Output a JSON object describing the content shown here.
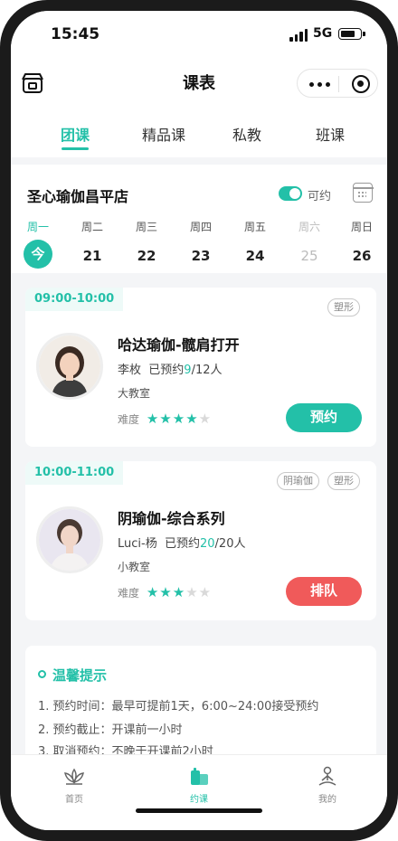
{
  "status": {
    "time": "15:45",
    "network": "5G"
  },
  "nav": {
    "title": "课表"
  },
  "tabs": [
    {
      "label": "团课",
      "active": true
    },
    {
      "label": "精品课",
      "active": false
    },
    {
      "label": "私教",
      "active": false
    },
    {
      "label": "班课",
      "active": false
    }
  ],
  "studio": {
    "name": "圣心瑜伽昌平店",
    "toggle_label": "可约",
    "toggle_on": true
  },
  "week": [
    {
      "weekday": "周一",
      "date": "今",
      "state": "today"
    },
    {
      "weekday": "周二",
      "date": "21",
      "state": "normal"
    },
    {
      "weekday": "周三",
      "date": "22",
      "state": "normal"
    },
    {
      "weekday": "周四",
      "date": "23",
      "state": "normal"
    },
    {
      "weekday": "周五",
      "date": "24",
      "state": "normal"
    },
    {
      "weekday": "周六",
      "date": "25",
      "state": "muted"
    },
    {
      "weekday": "周日",
      "date": "26",
      "state": "normal"
    }
  ],
  "courses": [
    {
      "time": "09:00-10:00",
      "tags": [
        "塑形"
      ],
      "name": "哈达瑜伽-髋肩打开",
      "teacher": "李枚",
      "booked_prefix": "已预约",
      "booked": "9",
      "capacity": "/12人",
      "room": "大教室",
      "difficulty_label": "难度",
      "rating": 4,
      "rating_max": 5,
      "action": "预约",
      "action_type": "book"
    },
    {
      "time": "10:00-11:00",
      "tags": [
        "阴瑜伽",
        "塑形"
      ],
      "name": "阴瑜伽-综合系列",
      "teacher": "Luci-杨",
      "booked_prefix": "已预约",
      "booked": "20",
      "capacity": "/20人",
      "room": "小教室",
      "difficulty_label": "难度",
      "rating": 3,
      "rating_max": 5,
      "action": "排队",
      "action_type": "queue"
    }
  ],
  "tips": {
    "title": "温馨提示",
    "lines": [
      "1. 预约时间：最早可提前1天，6:00~24:00接受预约",
      "2. 预约截止：开课前一小时",
      "3. 取消预约：不晚于开课前2小时"
    ]
  },
  "tabbar": [
    {
      "label": "首页",
      "icon": "lotus-icon",
      "active": false
    },
    {
      "label": "约课",
      "icon": "schedule-icon",
      "active": true
    },
    {
      "label": "我的",
      "icon": "meditation-person-icon",
      "active": false
    }
  ],
  "colors": {
    "accent": "#23c0a8",
    "queue": "#f05a5a"
  }
}
